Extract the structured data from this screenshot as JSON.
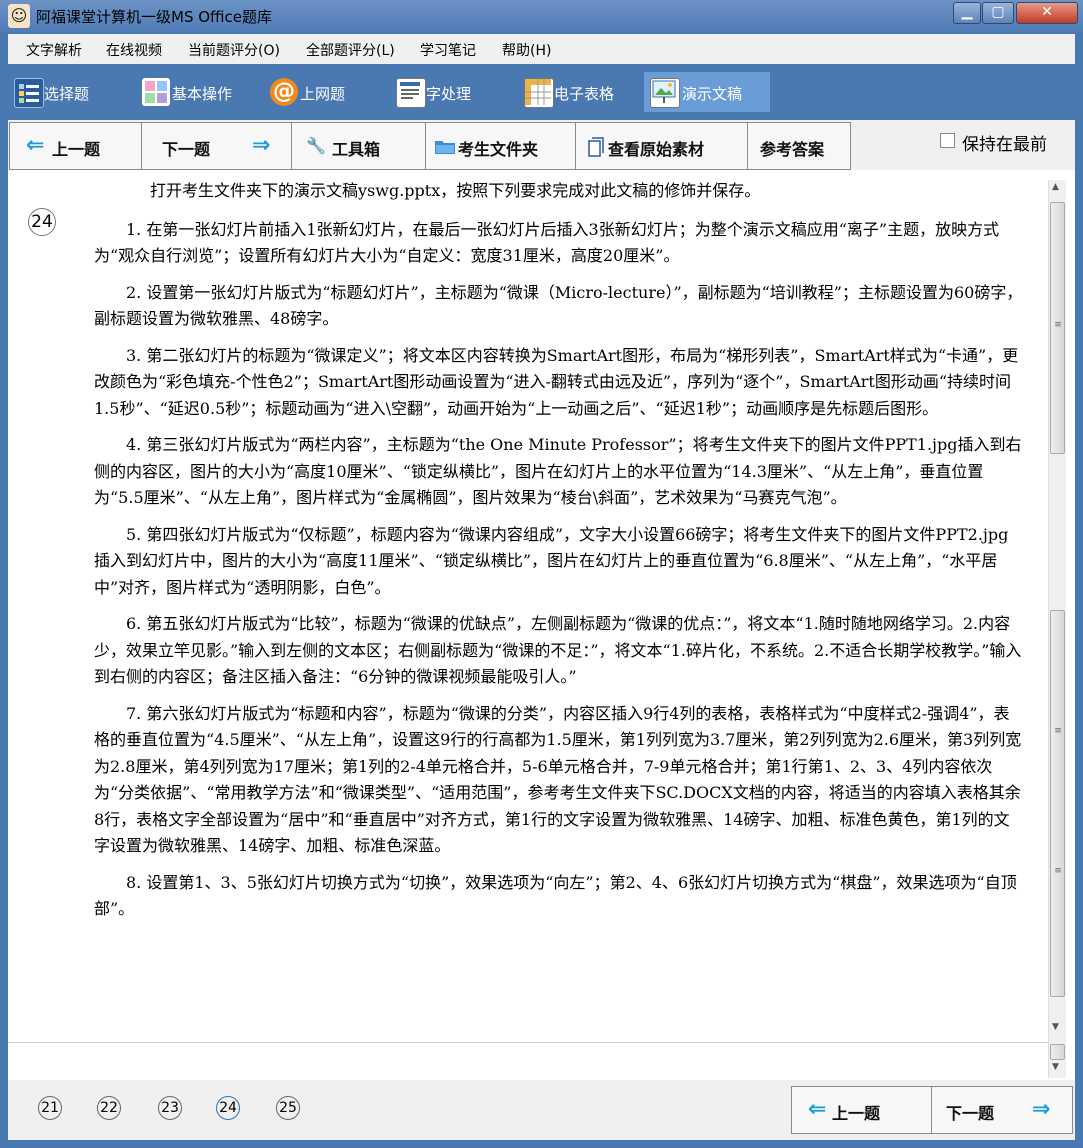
{
  "window": {
    "title": "阿福课堂计算机一级MS Office题库",
    "controls": {
      "minimize": "▁",
      "maximize": "▢",
      "close": "✕"
    }
  },
  "menu": [
    "文字解析",
    "在线视频",
    "当前题评分(O)",
    "全部题评分(L)",
    "学习笔记",
    "帮助(H)"
  ],
  "categories": [
    {
      "label": "选择题",
      "icon": "grid-icon"
    },
    {
      "label": "基本操作",
      "icon": "color-tiles-icon"
    },
    {
      "label": "上网题",
      "icon": "at-sign-icon"
    },
    {
      "label": "字处理",
      "icon": "document-icon"
    },
    {
      "label": "电子表格",
      "icon": "spreadsheet-icon"
    },
    {
      "label": "演示文稿",
      "icon": "presentation-icon"
    }
  ],
  "toolbar": {
    "prev": "上一题",
    "next": "下一题",
    "tools": "工具箱",
    "folder": "考生文件夹",
    "material": "查看原始素材",
    "answer": "参考答案",
    "keep_on_top": "保持在最前"
  },
  "question": {
    "number": "24",
    "paragraphs": [
      "打开考生文件夹下的演示文稿yswg.pptx，按照下列要求完成对此文稿的修饰并保存。",
      "1. 在第一张幻灯片前插入1张新幻灯片，在最后一张幻灯片后插入3张新幻灯片；为整个演示文稿应用“离子”主题，放映方式为“观众自行浏览”；设置所有幻灯片大小为“自定义：宽度31厘米，高度20厘米”。",
      "2. 设置第一张幻灯片版式为“标题幻灯片”，主标题为“微课（Micro-lecture）”，副标题为“培训教程”；主标题设置为60磅字，副标题设置为微软雅黑、48磅字。",
      "3. 第二张幻灯片的标题为“微课定义”；将文本区内容转换为SmartArt图形，布局为“梯形列表”，SmartArt样式为“卡通”，更改颜色为“彩色填充-个性色2”；SmartArt图形动画设置为“进入-翻转式由远及近”，序列为“逐个”，SmartArt图形动画“持续时间1.5秒”、“延迟0.5秒”；标题动画为“进入\\空翻”，动画开始为“上一动画之后”、“延迟1秒”；动画顺序是先标题后图形。",
      "4. 第三张幻灯片版式为“两栏内容”，主标题为“the One Minute Professor”；将考生文件夹下的图片文件PPT1.jpg插入到右侧的内容区，图片的大小为“高度10厘米”、“锁定纵横比”，图片在幻灯片上的水平位置为“14.3厘米”、“从左上角”，垂直位置为“5.5厘米”、“从左上角”，图片样式为“金属椭圆”，图片效果为“棱台\\斜面”，艺术效果为“马赛克气泡”。",
      "5. 第四张幻灯片版式为“仅标题”，标题内容为“微课内容组成”，文字大小设置66磅字；将考生文件夹下的图片文件PPT2.jpg插入到幻灯片中，图片的大小为“高度11厘米”、“锁定纵横比”，图片在幻灯片上的垂直位置为“6.8厘米”、“从左上角”，“水平居中”对齐，图片样式为“透明阴影，白色”。",
      "6. 第五张幻灯片版式为“比较”，标题为“微课的优缺点”，左侧副标题为“微课的优点：”，将文本“1.随时随地网络学习。2.内容少，效果立竿见影。”输入到左侧的文本区；右侧副标题为“微课的不足：”，将文本“1.碎片化，不系统。2.不适合长期学校教学。”输入到右侧的内容区；备注区插入备注：“6分钟的微课视频最能吸引人。”",
      "7. 第六张幻灯片版式为“标题和内容”，标题为“微课的分类”，内容区插入9行4列的表格，表格样式为“中度样式2-强调4”，表格的垂直位置为“4.5厘米”、“从左上角”，设置这9行的行高都为1.5厘米，第1列列宽为3.7厘米，第2列列宽为2.6厘米，第3列列宽为2.8厘米，第4列列宽为17厘米；第1列的2-4单元格合并，5-6单元格合并，7-9单元格合并；第1行第1、2、3、4列内容依次为“分类依据”、“常用教学方法”和“微课类型”、“适用范围”，参考考生文件夹下SC.DOCX文档的内容，将适当的内容填入表格其余8行，表格文字全部设置为“居中”和“垂直居中”对齐方式，第1行的文字设置为微软雅黑、14磅字、加粗、标准色黄色，第1列的文字设置为微软雅黑、14磅字、加粗、标准色深蓝。",
      "8. 设置第1、3、5张幻灯片切换方式为“切换”，效果选项为“向左”；第2、4、6张幻灯片切换方式为“棋盘”，效果选项为“自顶部”。"
    ]
  },
  "pager": [
    "21",
    "22",
    "23",
    "24",
    "25"
  ],
  "bottom": {
    "prev": "上一题",
    "next": "下一题"
  },
  "colors": {
    "window_blue": "#4a78b0",
    "active_tab": "#6a9dd8",
    "arrow": "#1d9bd8"
  }
}
